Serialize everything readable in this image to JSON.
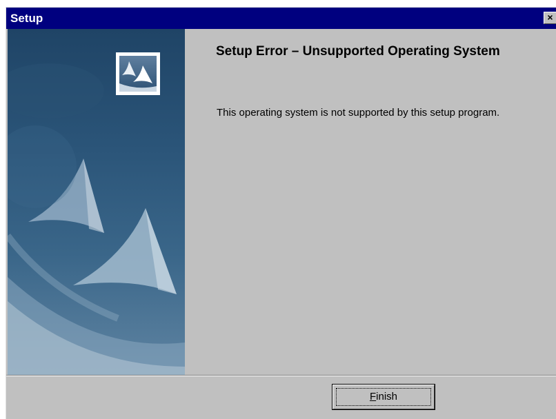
{
  "window": {
    "title": "Setup",
    "close_label": "×"
  },
  "content": {
    "heading": "Setup Error – Unsupported Operating System",
    "message": "This operating system is not supported by this setup program."
  },
  "footer": {
    "finish_mnemonic": "F",
    "finish_rest": "inish"
  },
  "icons": {
    "close": "close-icon",
    "logo": "tent-logo-icon",
    "side_art": "tent-artwork"
  },
  "colors": {
    "titlebar": "#00007f",
    "dialog_bg": "#c0c0c0",
    "side_panel_dark": "#1f4466",
    "side_panel_light": "#5f84a2"
  }
}
